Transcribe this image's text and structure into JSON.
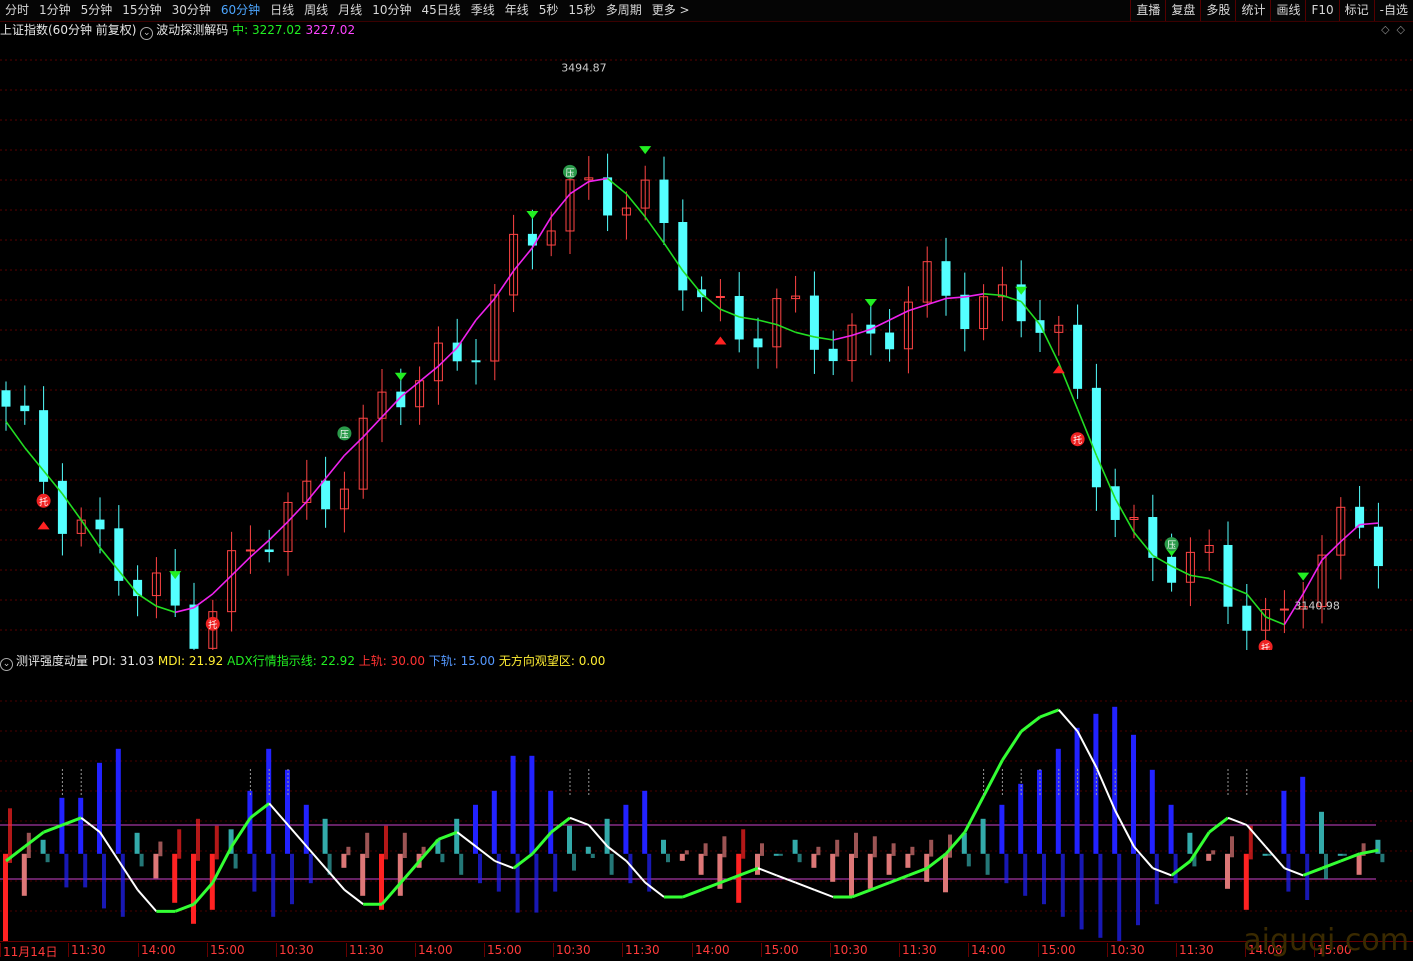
{
  "toolbar": {
    "periods": [
      "分时",
      "1分钟",
      "5分钟",
      "15分钟",
      "30分钟",
      "60分钟",
      "日线",
      "周线",
      "月线",
      "10分钟",
      "45日线",
      "季线",
      "年线",
      "5秒",
      "15秒",
      "多周期",
      "更多 >"
    ],
    "active": "60分钟",
    "actions": [
      "直播",
      "复盘",
      "多股",
      "统计",
      "画线",
      "F10",
      "标记",
      "-自选"
    ]
  },
  "main_title": {
    "symbol": "上证指数(60分钟 前复权)",
    "indicator": "波动探测解码",
    "mid_label": "中:",
    "mid_value": "3227.02",
    "mid_value2": "3227.02"
  },
  "indicator_title": {
    "name": "测评强度动量",
    "items": [
      {
        "label": "PDI:",
        "value": "31.03"
      },
      {
        "label": "MDI:",
        "value": "21.92"
      },
      {
        "label": "ADX行情指示线:",
        "value": "22.92"
      },
      {
        "label": "上轨:",
        "value": "30.00"
      },
      {
        "label": "下轨:",
        "value": "15.00"
      },
      {
        "label": "无方向观望区:",
        "value": "0.00"
      }
    ]
  },
  "annotations": {
    "high_label": "3494.87",
    "low_label": "3140.98",
    "marker_press": "压",
    "marker_support": "托"
  },
  "axis_ticks": [
    "11月14日",
    "11:30",
    "14:00",
    "15:00",
    "10:30",
    "11:30",
    "14:00",
    "15:00",
    "10:30",
    "11:30",
    "14:00",
    "15:00",
    "10:30",
    "11:30",
    "14:00",
    "15:00",
    "10:30",
    "11:30",
    "14:00",
    "15:00"
  ],
  "watermark": "aiguqi.com",
  "colors": {
    "up": "#ff4444",
    "down": "#54ffff",
    "ma_green": "#22dd22",
    "ma_magenta": "#ee22ee",
    "bg": "#000000"
  },
  "chart_data": {
    "type": "candlestick",
    "series": [
      {
        "name": "中",
        "values": [
          3262,
          3245,
          3230,
          3215,
          3198,
          3180,
          3165,
          3150,
          3142,
          3138,
          3141,
          3150,
          3162,
          3174,
          3185,
          3197,
          3210,
          3225,
          3240,
          3252,
          3265,
          3278,
          3288,
          3298,
          3310,
          3328,
          3342,
          3360,
          3375,
          3395,
          3410,
          3418,
          3420,
          3410,
          3395,
          3378,
          3360,
          3345,
          3335,
          3330,
          3328,
          3325,
          3320,
          3317,
          3315,
          3318,
          3322,
          3328,
          3334,
          3338,
          3342,
          3343,
          3345,
          3344,
          3340,
          3325,
          3300,
          3270,
          3240,
          3212,
          3190,
          3175,
          3168,
          3162,
          3160,
          3155,
          3150,
          3135,
          3130,
          3150,
          3172,
          3184,
          3195,
          3196
        ]
      },
      {
        "name": "PDI",
        "values": [
          10,
          18,
          28,
          34,
          30,
          38,
          40,
          22,
          15,
          12,
          10,
          12,
          25,
          32,
          40,
          36,
          30,
          28,
          20,
          16,
          14,
          16,
          20,
          24,
          28,
          30,
          32,
          40,
          38,
          30,
          24,
          20,
          26,
          28,
          30,
          22,
          20,
          18,
          16,
          14,
          18,
          20,
          22,
          18,
          16,
          14,
          15,
          17,
          18,
          16,
          15,
          26,
          28,
          30,
          34,
          36,
          40,
          44,
          46,
          48,
          42,
          36,
          30,
          26,
          22,
          18,
          14,
          24,
          34,
          36,
          30,
          22,
          18,
          24
        ]
      },
      {
        "name": "MDI",
        "values": [
          36,
          30,
          24,
          18,
          14,
          12,
          10,
          16,
          22,
          26,
          30,
          28,
          18,
          14,
          10,
          12,
          16,
          18,
          24,
          28,
          30,
          28,
          24,
          20,
          18,
          16,
          14,
          12,
          10,
          12,
          16,
          18,
          16,
          14,
          12,
          18,
          22,
          24,
          26,
          28,
          24,
          20,
          18,
          22,
          24,
          26,
          25,
          23,
          22,
          24,
          26,
          20,
          18,
          16,
          14,
          12,
          10,
          8,
          6,
          6,
          8,
          12,
          16,
          20,
          24,
          28,
          30,
          24,
          16,
          14,
          18,
          22,
          24,
          20
        ]
      },
      {
        "name": "ADX行情指示线",
        "values": [
          20,
          24,
          28,
          30,
          32,
          28,
          20,
          12,
          6,
          6,
          8,
          14,
          24,
          32,
          36,
          30,
          24,
          18,
          12,
          8,
          8,
          14,
          20,
          26,
          28,
          24,
          20,
          18,
          22,
          28,
          32,
          30,
          24,
          20,
          14,
          10,
          10,
          12,
          14,
          16,
          18,
          16,
          14,
          12,
          10,
          10,
          12,
          14,
          16,
          18,
          22,
          28,
          38,
          48,
          56,
          60,
          62,
          56,
          46,
          34,
          24,
          18,
          16,
          20,
          28,
          32,
          30,
          24,
          18,
          16,
          18,
          20,
          22,
          23
        ]
      }
    ],
    "ylim": [
      3140.98,
      3494.87
    ],
    "reference_lines": [
      30,
      15
    ]
  }
}
